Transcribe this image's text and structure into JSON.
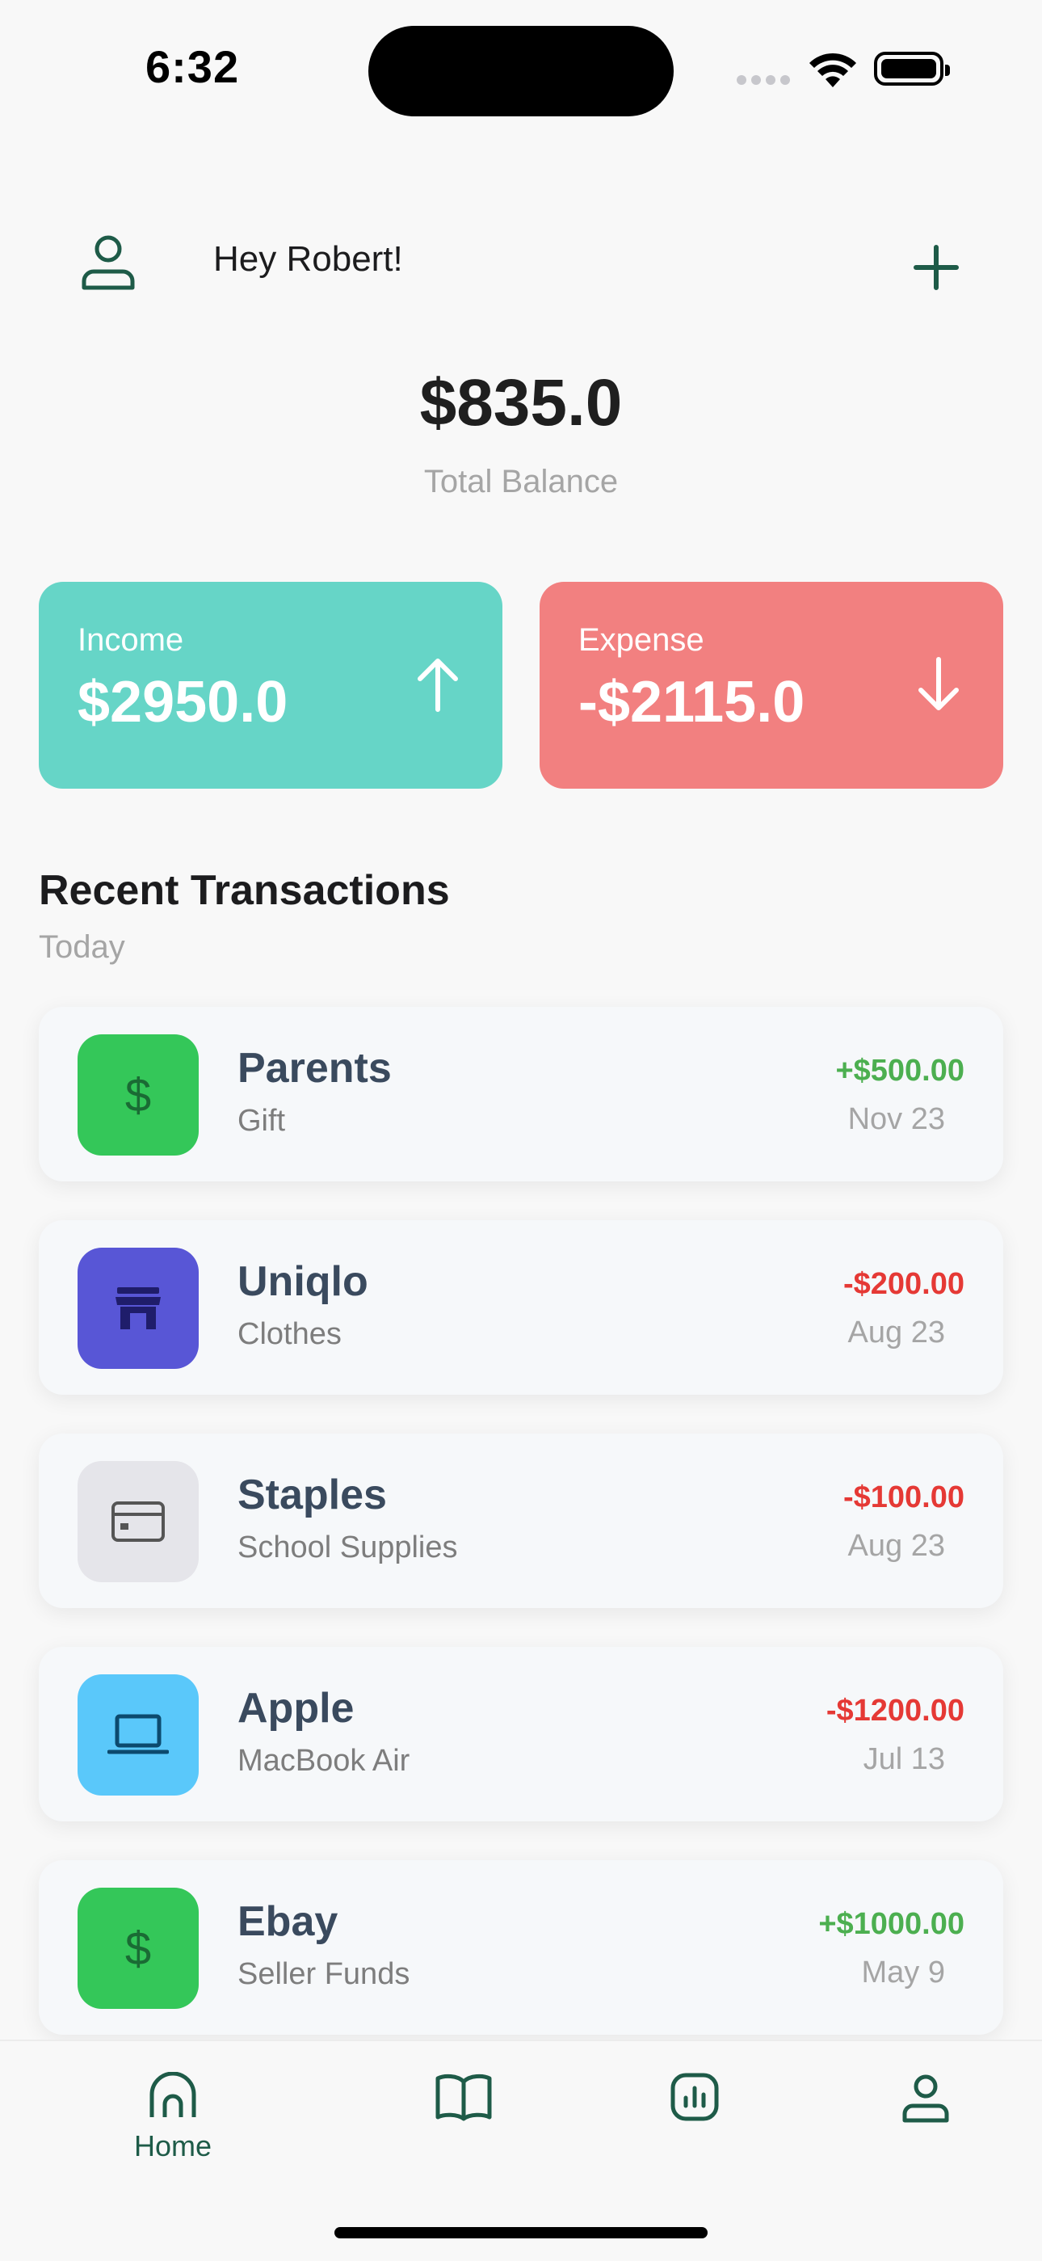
{
  "status_bar": {
    "time": "6:32"
  },
  "header": {
    "greeting": "Hey Robert!"
  },
  "balance": {
    "amount": "$835.0",
    "label": "Total Balance"
  },
  "summary": {
    "income": {
      "label": "Income",
      "value": "$2950.0"
    },
    "expense": {
      "label": "Expense",
      "value": "-$2115.0"
    }
  },
  "transactions_section": {
    "title": "Recent Transactions",
    "subtitle": "Today"
  },
  "transactions": [
    {
      "name": "Parents",
      "category": "Gift",
      "amount": "+$500.00",
      "date": "Nov 23",
      "icon": "dollar-icon",
      "icon_bg": "#34c759"
    },
    {
      "name": "Uniqlo",
      "category": "Clothes",
      "amount": "-$200.00",
      "date": "Aug 23",
      "icon": "store-icon",
      "icon_bg": "#5856d6"
    },
    {
      "name": "Staples",
      "category": "School Supplies",
      "amount": "-$100.00",
      "date": "Aug 23",
      "icon": "credit-card-icon",
      "icon_bg": "#e5e5ea"
    },
    {
      "name": "Apple",
      "category": "MacBook Air",
      "amount": "-$1200.00",
      "date": "Jul 13",
      "icon": "laptop-icon",
      "icon_bg": "#5ac8fa"
    },
    {
      "name": "Ebay",
      "category": "Seller Funds",
      "amount": "+$1000.00",
      "date": "May 9",
      "icon": "dollar-icon",
      "icon_bg": "#34c759"
    }
  ],
  "tabbar": {
    "home": "Home"
  },
  "colors": {
    "income": "#66d5c7",
    "expense": "#f28080",
    "positive": "#4caf50",
    "negative": "#e53935",
    "accent": "#1e5b48"
  }
}
